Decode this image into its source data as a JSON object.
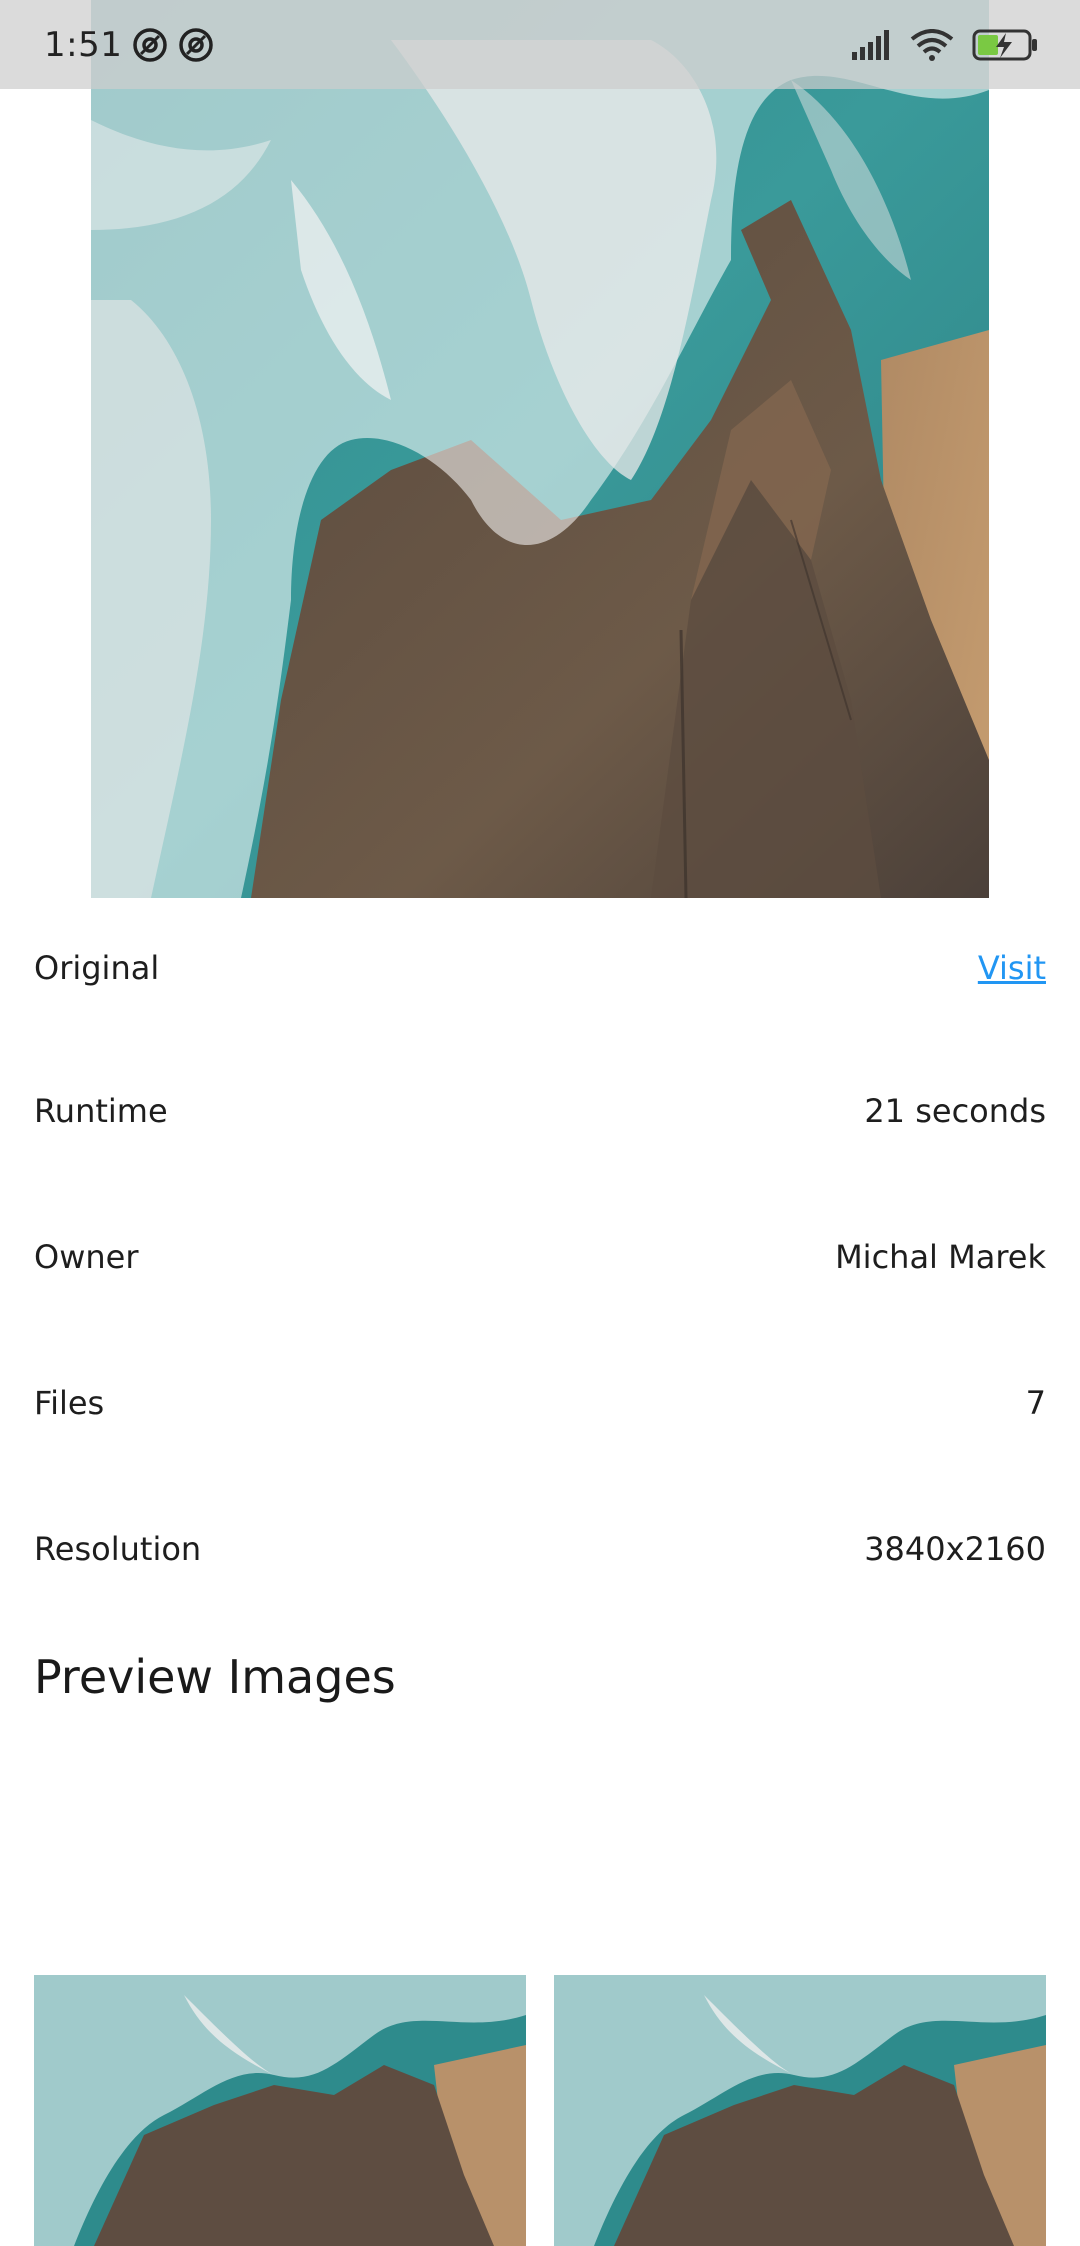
{
  "status_bar": {
    "time": "1:51",
    "icons": [
      "notification-at-icon",
      "notification-at-icon",
      "signal-icon",
      "wifi-icon",
      "battery-charging-icon"
    ]
  },
  "hero": {
    "image": "aerial-ocean-rocks-photo"
  },
  "details": [
    {
      "label": "Original",
      "value": "Visit",
      "is_link": true
    },
    {
      "label": "Runtime",
      "value": "21 seconds"
    },
    {
      "label": "Owner",
      "value": "Michal Marek"
    },
    {
      "label": "Files",
      "value": "7"
    },
    {
      "label": "Resolution",
      "value": "3840x2160"
    }
  ],
  "section": {
    "title": "Preview Images"
  },
  "previews": [
    {
      "image": "aerial-ocean-rocks-thumbnail"
    },
    {
      "image": "aerial-ocean-rocks-thumbnail"
    }
  ]
}
